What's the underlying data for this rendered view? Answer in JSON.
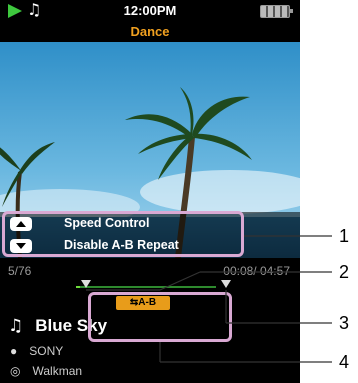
{
  "status": {
    "time": "12:00PM"
  },
  "playlist_title": "Dance",
  "options": [
    {
      "key_icon": "triangle-up-icon",
      "label": "Speed Control"
    },
    {
      "key_icon": "triangle-down-icon",
      "label": "Disable A-B Repeat"
    }
  ],
  "player": {
    "track_position": "5/76",
    "time": "00:08/ 04:57",
    "progress": 0.03,
    "ab_badge": "A-B",
    "song_title": "Blue Sky",
    "artist": "SONY",
    "album": "Walkman"
  },
  "callouts": [
    "1",
    "2",
    "3",
    "4"
  ],
  "colors": {
    "accent": "#f0a020",
    "progress": "#6ddb3b",
    "callout_box": "#d9a9d3",
    "ab_badge": "#e89c1a"
  }
}
